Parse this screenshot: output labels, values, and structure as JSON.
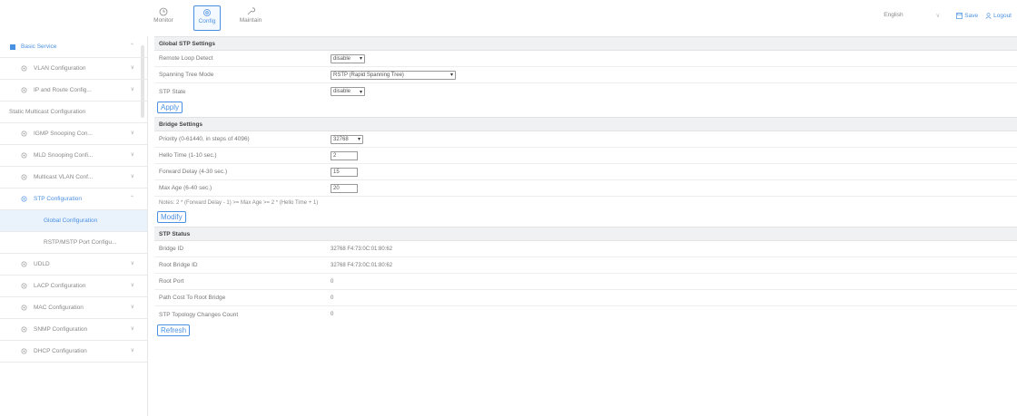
{
  "topbar": {
    "nav": [
      {
        "label": "Monitor",
        "icon": "clock-icon",
        "active": false
      },
      {
        "label": "Config",
        "icon": "settings-icon",
        "active": true
      },
      {
        "label": "Maintain",
        "icon": "wrench-icon",
        "active": false
      }
    ],
    "language": "English",
    "save_label": "Save",
    "logout_label": "Logout",
    "accent_color": "#4a90e2"
  },
  "sidebar": {
    "top": {
      "label": "Basic Service"
    },
    "items": [
      {
        "label": "VLAN Configuration"
      },
      {
        "label": "IP and Route Config..."
      },
      {
        "label": "Static Multicast Configuration"
      },
      {
        "label": "IGMP Snooping Con..."
      },
      {
        "label": "MLD Snooping Confi..."
      },
      {
        "label": "Multicast VLAN Conf..."
      },
      {
        "label": "STP Configuration"
      },
      {
        "label": "Global Configuration"
      },
      {
        "label": "RSTP/MSTP Port Configu..."
      },
      {
        "label": "UDLD"
      },
      {
        "label": "LACP Configuration"
      },
      {
        "label": "MAC Configuration"
      },
      {
        "label": "SNMP Configuration"
      },
      {
        "label": "DHCP Configuration"
      }
    ]
  },
  "global_stp": {
    "title": "Global STP Settings",
    "rows": [
      {
        "label": "Remote Loop Detect",
        "value": "disable"
      },
      {
        "label": "Spanning Tree Mode",
        "value": "RSTP (Rapid Spanning Tree)"
      },
      {
        "label": "STP State",
        "value": "disable"
      }
    ],
    "apply_label": "Apply"
  },
  "bridge": {
    "title": "Bridge Settings",
    "priority_label": "Priority (0-61440, in steps of 4096)",
    "priority_value": "32768",
    "hello_label": "Hello Time (1-10 sec.)",
    "hello_value": "2",
    "forward_label": "Forward Delay (4-30 sec.)",
    "forward_value": "15",
    "maxage_label": "Max Age (6-40 sec.)",
    "maxage_value": "20",
    "note": "Notes: 2 * (Forward Delay - 1) >= Max Age >= 2 * (Hello Time + 1)",
    "modify_label": "Modify"
  },
  "stp_status": {
    "title": "STP Status",
    "rows": [
      {
        "label": "Bridge ID",
        "value": "32768 F4:73:0C:01:80:62"
      },
      {
        "label": "Root Bridge ID",
        "value": "32768 F4:73:0C:01:80:62"
      },
      {
        "label": "Root Port",
        "value": "0"
      },
      {
        "label": "Path Cost To Root Bridge",
        "value": "0"
      },
      {
        "label": "STP Topology Changes Count",
        "value": "0"
      }
    ],
    "refresh_label": "Refresh"
  }
}
